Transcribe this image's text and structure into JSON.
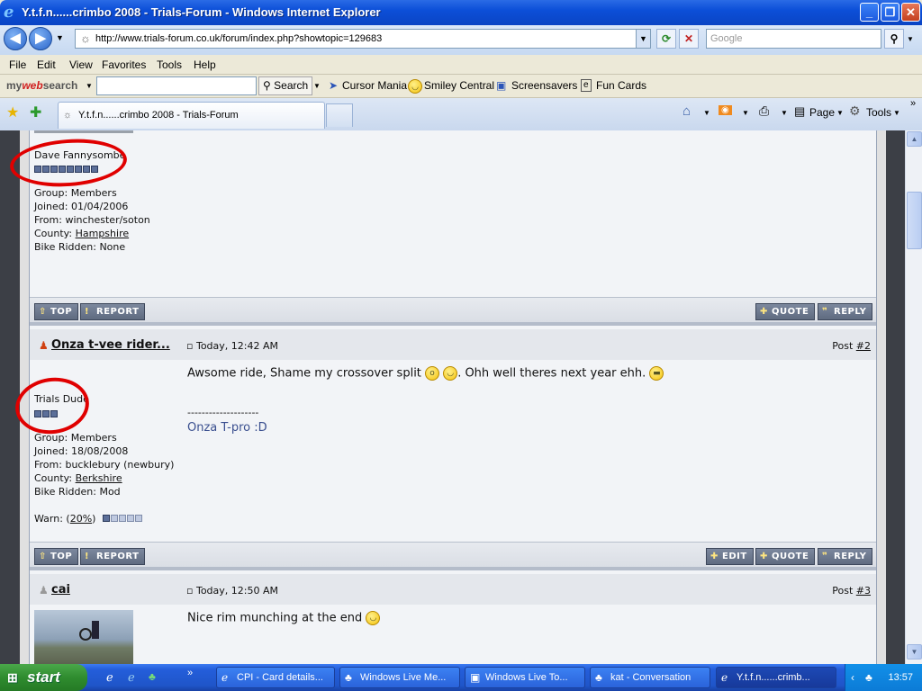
{
  "window": {
    "title": "Y.t.f.n......crimbo 2008 - Trials-Forum - Windows Internet Explorer"
  },
  "nav": {
    "url": "http://www.trials-forum.co.uk/forum/index.php?showtopic=129683",
    "search_placeholder": "Google"
  },
  "menu": [
    "File",
    "Edit",
    "View",
    "Favorites",
    "Tools",
    "Help"
  ],
  "toolbar": {
    "brand_my": "my",
    "brand_web": "web",
    "brand_search": "search",
    "search_button": "Search",
    "links": [
      "Cursor Mania",
      "Smiley Central",
      "Screensavers",
      "Fun Cards"
    ]
  },
  "tabs": {
    "active_title": "Y.t.f.n......crimbo 2008 - Trials-Forum",
    "page_label": "Page",
    "tools_label": "Tools"
  },
  "posts": [
    {
      "title": "Dave Fannysombe",
      "pips": 8,
      "group": "Group: Members",
      "joined": "Joined: 01/04/2006",
      "from": "From: winchester/soton",
      "county_label": "County: ",
      "county": "Hampshire",
      "bike": "Bike Ridden: None",
      "buttons": [
        "TOP",
        "REPORT",
        "QUOTE",
        "REPLY"
      ]
    },
    {
      "username": "Onza t-vee rider...",
      "date": "Today, 12:42 AM",
      "post_label": "Post ",
      "post_num": "#2",
      "message": "Awsome ride, Shame my crossover split",
      "message2": ". Ohh well theres next year ehh.",
      "signature_rule": "--------------------",
      "signature": "Onza T-pro :D",
      "title": "Trials Dude",
      "pips": 3,
      "group": "Group: Members",
      "joined": "Joined: 18/08/2008",
      "from": "From: bucklebury (newbury)",
      "county_label": "County: ",
      "county": "Berkshire",
      "bike": "Bike Ridden: Mod",
      "warn_label": "Warn: (",
      "warn_value": "20%",
      "warn_close": ")",
      "warn_level": 0.2,
      "buttons": [
        "TOP",
        "REPORT",
        "EDIT",
        "QUOTE",
        "REPLY"
      ]
    },
    {
      "username": "cai",
      "date": "Today, 12:50 AM",
      "post_label": "Post ",
      "post_num": "#3",
      "message": "Nice rim munching at the end"
    }
  ],
  "taskbar": {
    "start": "start",
    "tasks": [
      "CPI - Card details...",
      "Windows Live Me...",
      "Windows Live To...",
      "kat - Conversation",
      "Y.t.f.n......crimb..."
    ],
    "clock": "13:57"
  }
}
